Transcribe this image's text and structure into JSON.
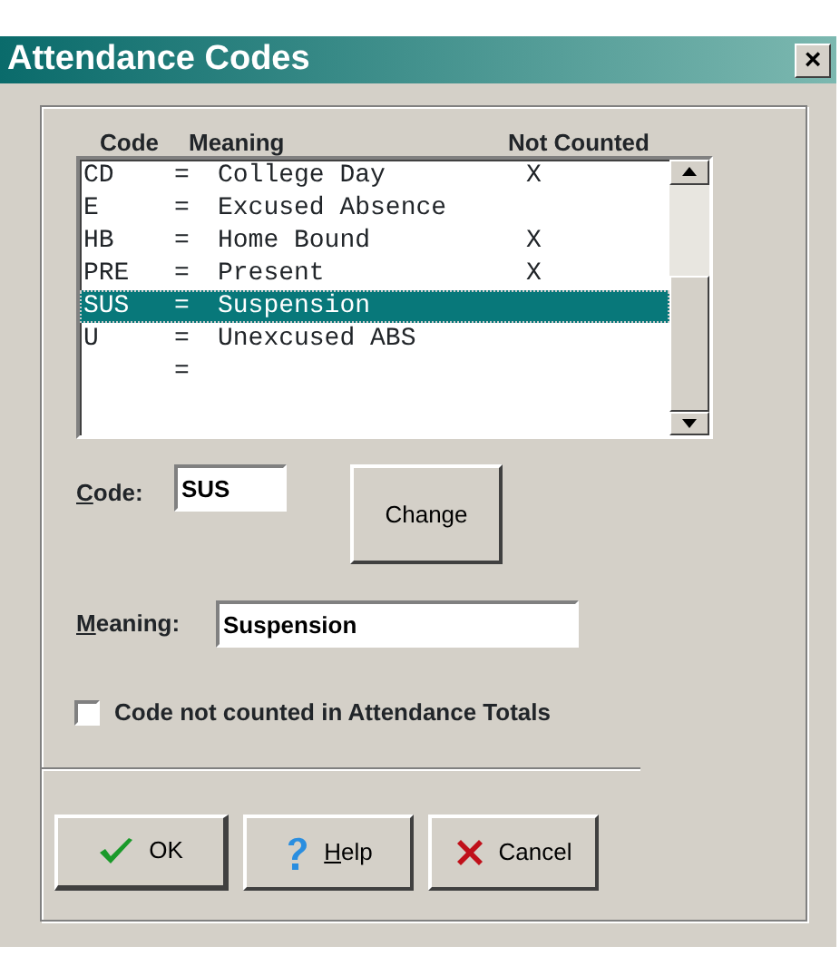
{
  "window": {
    "title": "Attendance Codes",
    "close": "×"
  },
  "list": {
    "columns": [
      "Code",
      "Meaning",
      "Not Counted"
    ],
    "rows": [
      {
        "code": "CD",
        "equals": "=",
        "meaning": "College Day",
        "not_counted": "X",
        "selected": false
      },
      {
        "code": "E",
        "equals": "=",
        "meaning": "Excused Absence",
        "selected": false
      },
      {
        "code": "HB",
        "equals": "=",
        "meaning": "Home Bound",
        "not_counted": "X",
        "selected": false
      },
      {
        "code": "PRE",
        "equals": "=",
        "meaning": "Present",
        "not_counted": "X",
        "selected": false
      },
      {
        "code": "SUS",
        "equals": "=",
        "meaning": "Suspension",
        "selected": true
      },
      {
        "code": "U",
        "equals": "=",
        "meaning": "Unexcused ABS",
        "selected": false
      },
      {
        "equals": "=",
        "selected": false
      }
    ]
  },
  "code_field": {
    "label": "Code:",
    "value": "SUS",
    "access_key": true
  },
  "change_button": "Change",
  "meaning_field": {
    "label": "Meaning:",
    "value": "Suspension",
    "access_key": true
  },
  "checkbox": {
    "label": "Code not counted in Attendance Totals",
    "checked": false
  },
  "buttons": [
    {
      "kind": "ok",
      "label": "OK",
      "access_key": false
    },
    {
      "kind": "help",
      "label": "Help",
      "access_key": true
    },
    {
      "kind": "cancel",
      "label": "Cancel",
      "access_key": false
    }
  ]
}
